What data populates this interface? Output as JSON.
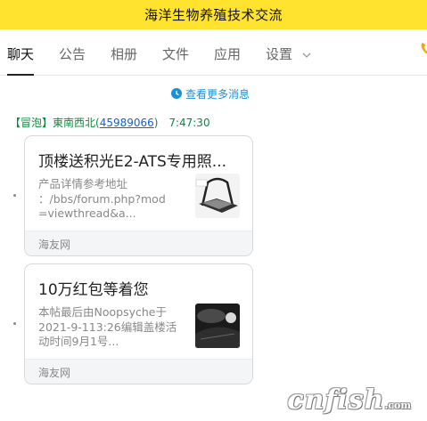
{
  "window": {
    "title": "海洋生物养殖技术交流"
  },
  "tabs": [
    {
      "label": "聊天",
      "active": true
    },
    {
      "label": "公告",
      "active": false
    },
    {
      "label": "相册",
      "active": false
    },
    {
      "label": "文件",
      "active": false
    },
    {
      "label": "应用",
      "active": false
    },
    {
      "label": "设置",
      "active": false
    }
  ],
  "chat": {
    "more_messages": "查看更多消息",
    "message": {
      "tag": "【冒泡】",
      "name": "東南西北",
      "qq_open": "(",
      "qq": "45989066",
      "qq_close": ")",
      "time": "7:47:30"
    },
    "cards": [
      {
        "title": "顶楼送积光E2-ATS专用照...",
        "desc_lines": [
          "产品详情参考地址",
          "：/bbs/forum.php?mod",
          "=viewthread&a..."
        ],
        "source": "海友网",
        "thumb_icon": "aquarium-light-icon"
      },
      {
        "title": "10万红包等着您",
        "desc_lines": [
          "本帖最后由Noopsyche于",
          "2021-9-113:26编辑盖楼活",
          "动时间9月1号..."
        ],
        "source": "海友网",
        "thumb_icon": "dark-product-photo-icon"
      }
    ]
  },
  "watermark": {
    "main": "cnfish",
    "suffix": ".com"
  },
  "colors": {
    "title_bar": "#ffe32e",
    "link": "#1a8fd8",
    "sender": "#0b8a3e"
  }
}
